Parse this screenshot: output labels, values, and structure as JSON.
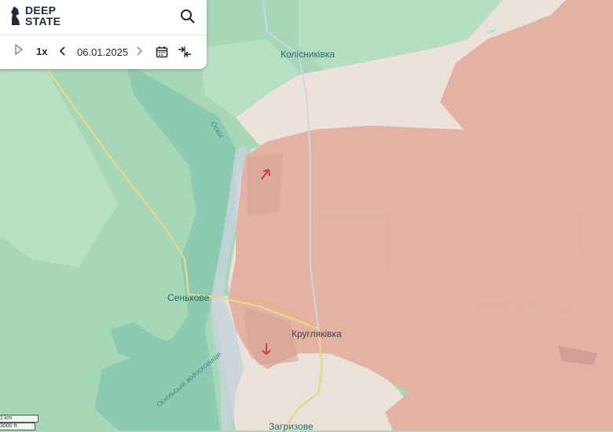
{
  "app": {
    "logo_line1": "DEEP",
    "logo_line2": "STATE"
  },
  "toolbar": {
    "speed": "1x",
    "date": "06.01.2025"
  },
  "map": {
    "places": [
      {
        "id": "kolisnykivka",
        "name": "Колісниківка"
      },
      {
        "id": "senkove",
        "name": "Сеньковe"
      },
      {
        "id": "kruhliakivka",
        "name": "Кругляківка"
      },
      {
        "id": "zahryzove",
        "name": "Загризове"
      }
    ],
    "river": "Оскіл",
    "reservoir": "Оскільське водосховище",
    "colors": {
      "occupied": "#e8b0a4",
      "gray_zone": "#ece2da",
      "land": "#a8d8b8",
      "water": "#88c8b0",
      "road": "#e0d890"
    }
  },
  "scale": {
    "km": "1 km",
    "ft": "3000 ft"
  }
}
